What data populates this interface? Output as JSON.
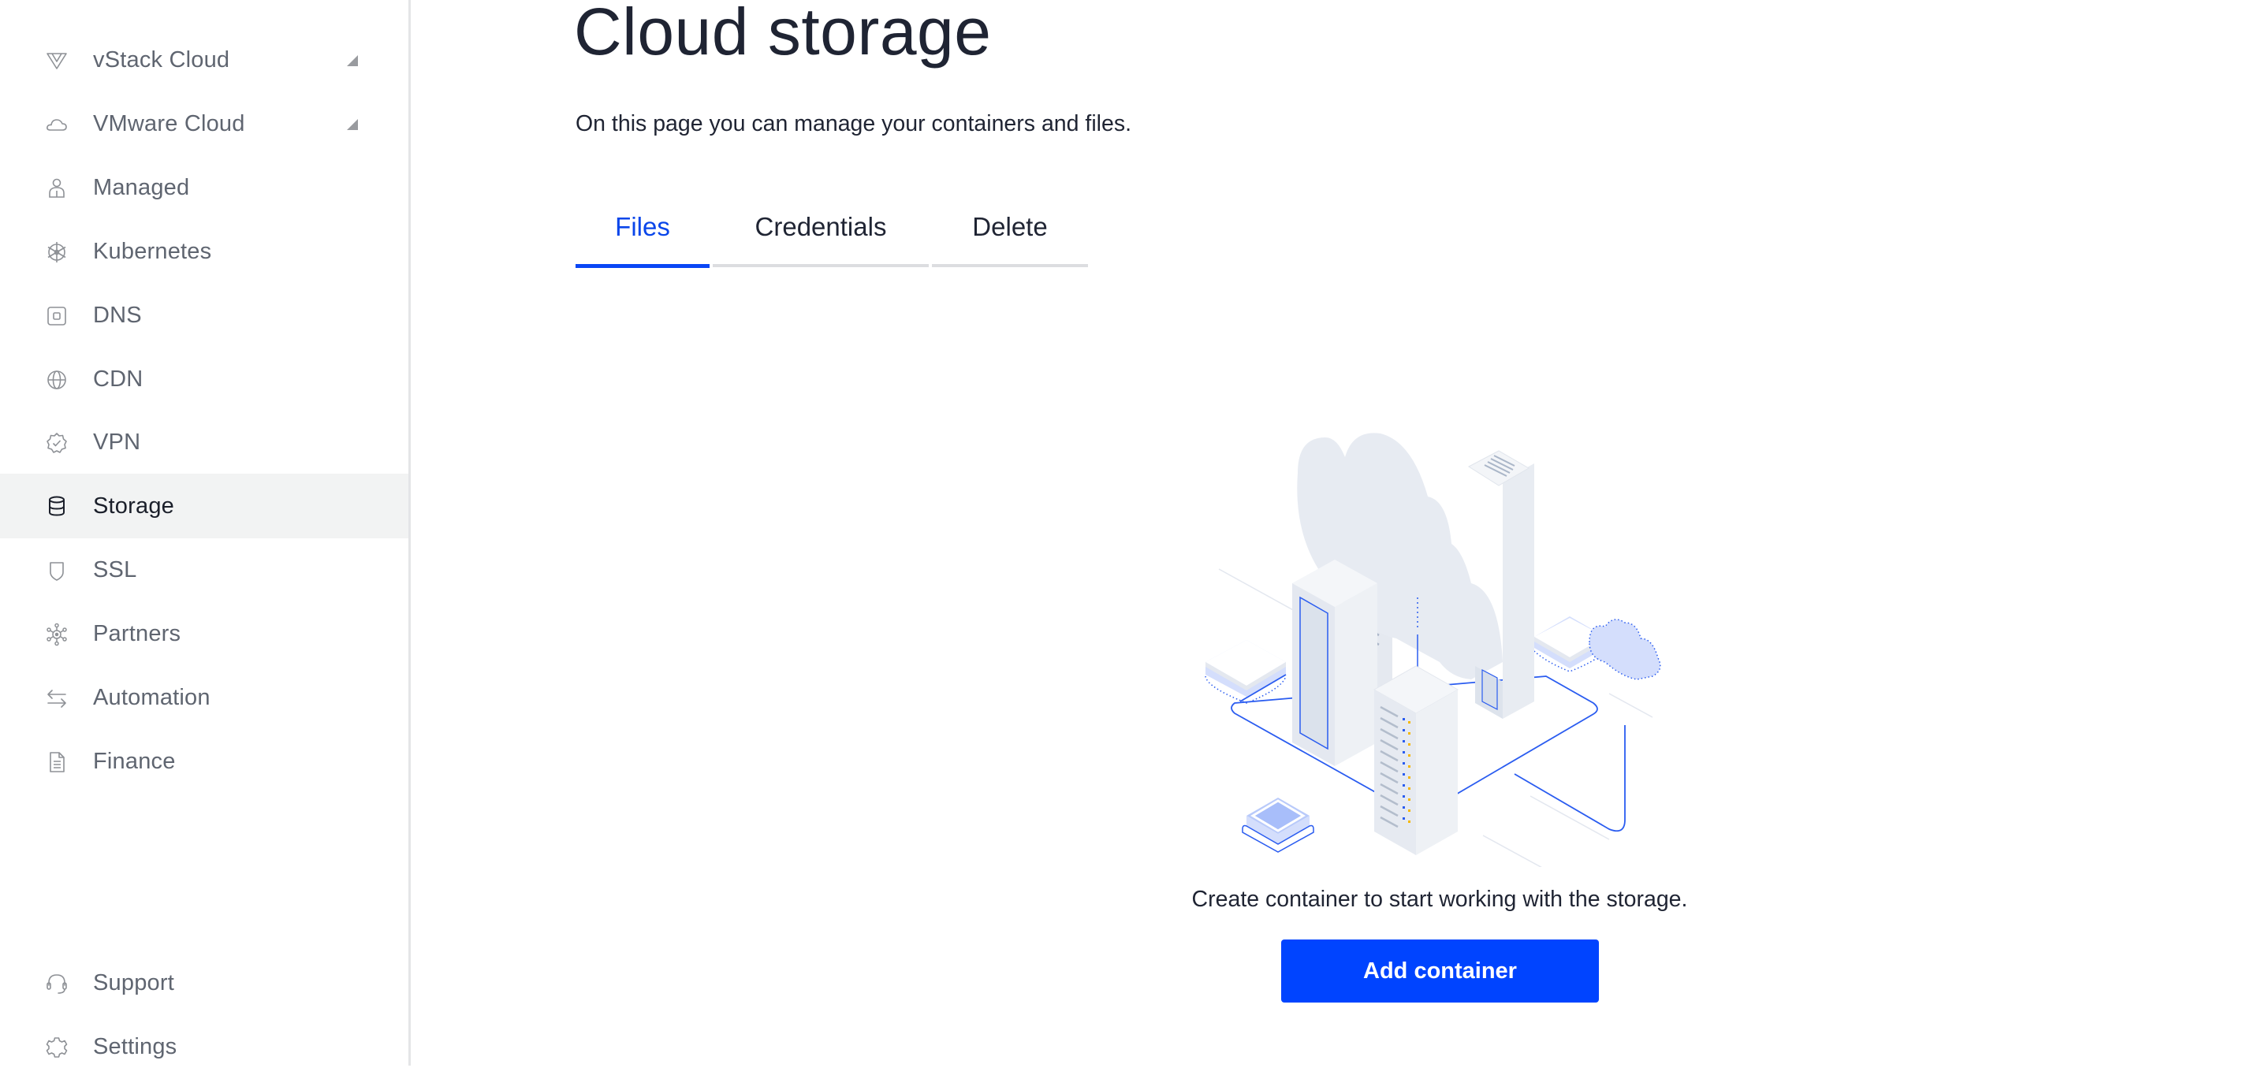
{
  "sidebar": {
    "items": [
      {
        "label": "vStack Cloud",
        "icon": "vstack-icon",
        "expandable": true
      },
      {
        "label": "VMware Cloud",
        "icon": "cloud-icon",
        "expandable": true
      },
      {
        "label": "Managed",
        "icon": "user-icon"
      },
      {
        "label": "Kubernetes",
        "icon": "helm-wheel-icon"
      },
      {
        "label": "DNS",
        "icon": "dns-icon"
      },
      {
        "label": "CDN",
        "icon": "globe-icon"
      },
      {
        "label": "VPN",
        "icon": "badge-check-icon"
      },
      {
        "label": "Storage",
        "icon": "database-icon",
        "active": true
      },
      {
        "label": "SSL",
        "icon": "shield-icon"
      },
      {
        "label": "Partners",
        "icon": "network-hub-icon"
      },
      {
        "label": "Automation",
        "icon": "arrows-swap-icon"
      },
      {
        "label": "Finance",
        "icon": "document-icon"
      }
    ],
    "footer": [
      {
        "label": "Support",
        "icon": "headset-icon"
      },
      {
        "label": "Settings",
        "icon": "gear-icon"
      }
    ]
  },
  "page": {
    "title": "Cloud storage",
    "subtitle": "On this page you can manage your containers and files."
  },
  "tabs": [
    {
      "label": "Files",
      "active": true
    },
    {
      "label": "Credentials",
      "active": false
    },
    {
      "label": "Delete",
      "active": false
    }
  ],
  "empty_state": {
    "illustration": "cloud-servers-illustration",
    "caption": "Create container to start working with the storage.",
    "button_label": "Add container"
  },
  "colors": {
    "accent": "#0044ff",
    "active_tab": "#0a46ea",
    "sidebar_active_bg": "#f2f3f3",
    "text_primary": "#1f2433",
    "text_muted": "#5f6570"
  }
}
